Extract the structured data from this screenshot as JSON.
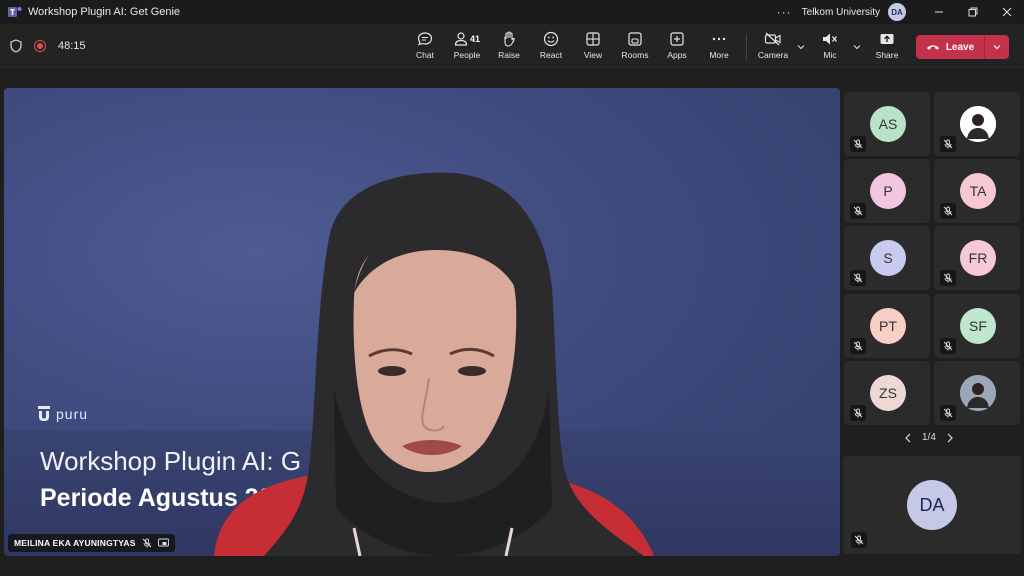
{
  "window": {
    "title": "Workshop Plugin AI: Get Genie",
    "org": "Telkom University",
    "user_initials": "DA",
    "more_label": "···"
  },
  "toolbar": {
    "timer": "48:15",
    "chat_label": "Chat",
    "people_label": "People",
    "people_count": "41",
    "raise_label": "Raise",
    "react_label": "React",
    "view_label": "View",
    "rooms_label": "Rooms",
    "apps_label": "Apps",
    "more_label": "More",
    "camera_label": "Camera",
    "mic_label": "Mic",
    "share_label": "Share",
    "leave_label": "Leave"
  },
  "stage": {
    "slide_logo_text": "puru",
    "slide_title_line1": "Workshop Plugin AI: G",
    "slide_title_line2": "Periode Agustus 202",
    "speaker_name": "MEILINA EKA AYUNINGTYAS"
  },
  "gallery": {
    "tiles": [
      {
        "initials": "AS",
        "color": "#b9e3c9"
      },
      {
        "initials": "",
        "color": "#ffffff"
      },
      {
        "initials": "P",
        "color": "#f3c6df"
      },
      {
        "initials": "TA",
        "color": "#f6c9d2"
      },
      {
        "initials": "S",
        "color": "#c8cbef"
      },
      {
        "initials": "FR",
        "color": "#f6c9d6"
      },
      {
        "initials": "PT",
        "color": "#f7cfc7"
      },
      {
        "initials": "SF",
        "color": "#bfe6cf"
      },
      {
        "initials": "ZS",
        "color": "#ecd9d4"
      },
      {
        "initials": "",
        "color": "#9aa7b8"
      }
    ],
    "pager": "1/4",
    "self_initials": "DA"
  },
  "colors": {
    "accent_leave": "#c4314b",
    "stage_bg": "#3f4a7e",
    "app_bg": "#1f1f1f"
  }
}
